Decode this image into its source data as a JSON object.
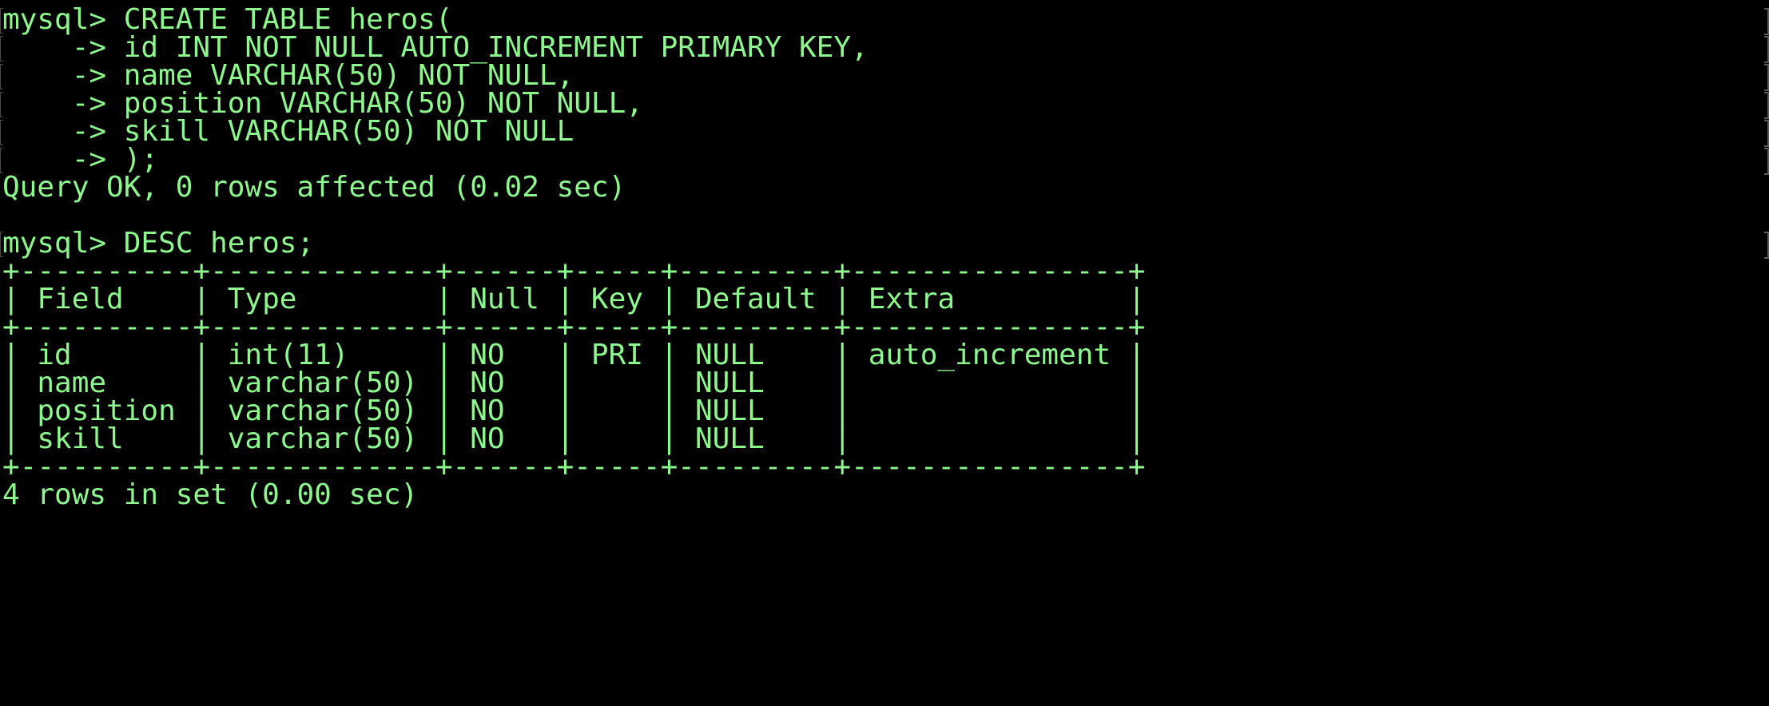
{
  "terminal": {
    "text_color": "#8EF78E",
    "background_color": "#000000",
    "lines": [
      "mysql> CREATE TABLE heros(",
      "    -> id INT NOT NULL AUTO_INCREMENT PRIMARY KEY,",
      "    -> name VARCHAR(50) NOT NULL,",
      "    -> position VARCHAR(50) NOT NULL,",
      "    -> skill VARCHAR(50) NOT NULL",
      "    -> );",
      "Query OK, 0 rows affected (0.02 sec)",
      "",
      "mysql> DESC heros;",
      "+----------+-------------+------+-----+---------+----------------+",
      "| Field    | Type        | Null | Key | Default | Extra          |",
      "+----------+-------------+------+-----+---------+----------------+",
      "| id       | int(11)     | NO   | PRI | NULL    | auto_increment |",
      "| name     | varchar(50) | NO   |     | NULL    |                |",
      "| position | varchar(50) | NO   |     | NULL    |                |",
      "| skill    | varchar(50) | NO   |     | NULL    |                |",
      "+----------+-------------+------+-----+---------+----------------+",
      "4 rows in set (0.00 sec)"
    ]
  }
}
